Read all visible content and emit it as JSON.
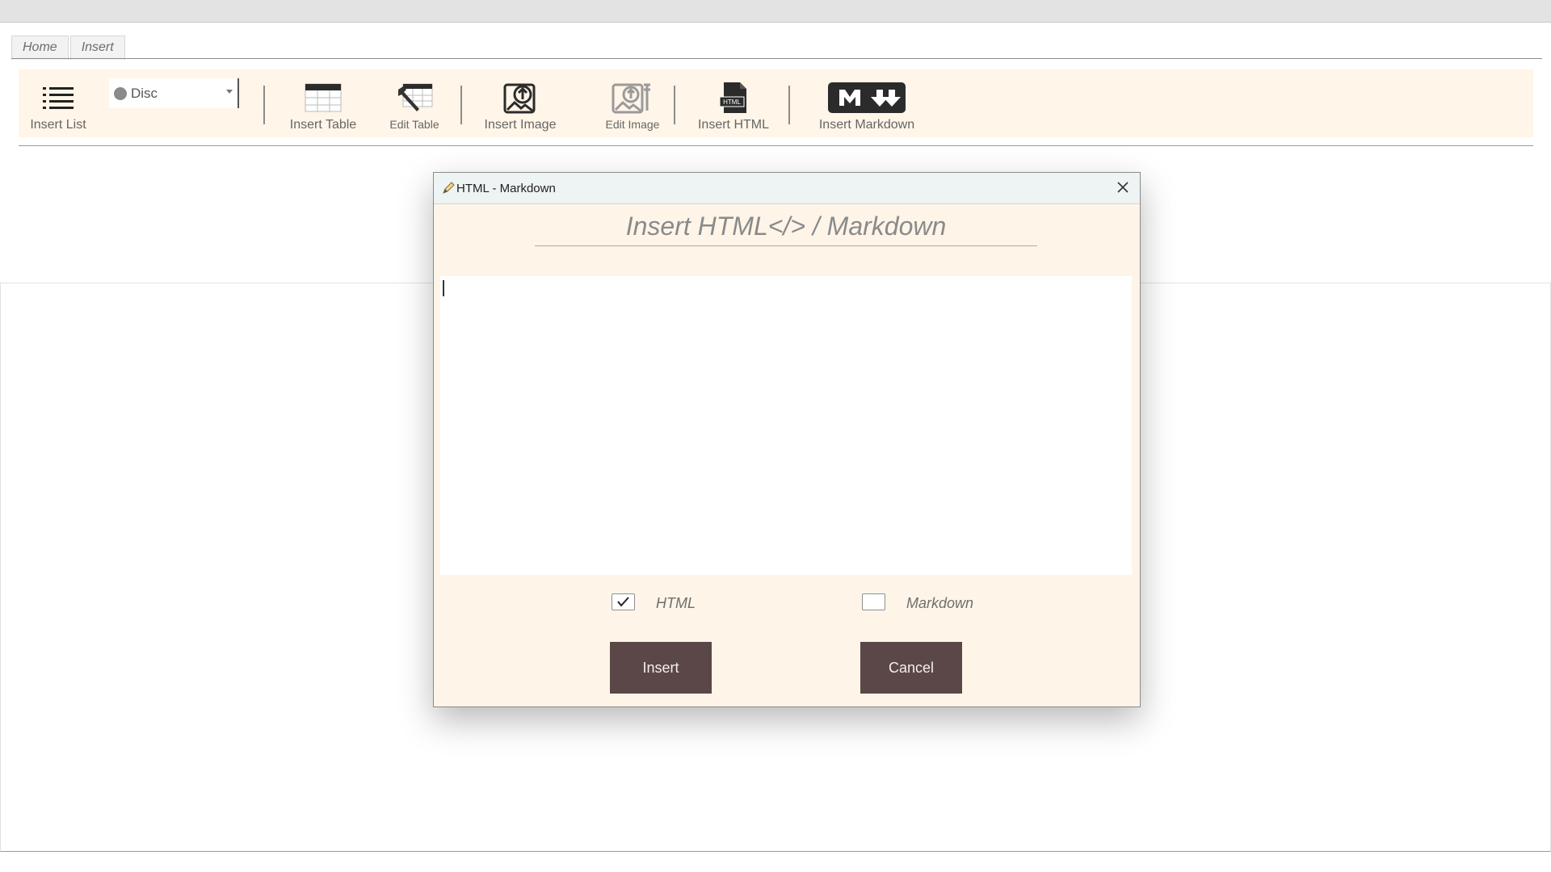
{
  "tabs": [
    {
      "label": "Home"
    },
    {
      "label": "Insert"
    }
  ],
  "ribbon": {
    "insert_list": "Insert List",
    "list_style_value": "Disc",
    "insert_table": "Insert Table",
    "edit_table": "Edit Table",
    "insert_image": "Insert Image",
    "edit_image": "Edit Image",
    "insert_html": "Insert HTML",
    "insert_markdown": "Insert Markdown",
    "html_icon_text": "HTML"
  },
  "dialog": {
    "title": "HTML - Markdown",
    "heading": "Insert HTML</> / Markdown",
    "textarea_value": "",
    "options": {
      "html_label": "HTML",
      "html_checked": true,
      "markdown_label": "Markdown",
      "markdown_checked": false
    },
    "insert_button": "Insert",
    "cancel_button": "Cancel"
  },
  "colors": {
    "ribbon_bg": "#fff5e8",
    "dialog_bg": "#fef5e8",
    "button_bg": "#5b4747"
  }
}
